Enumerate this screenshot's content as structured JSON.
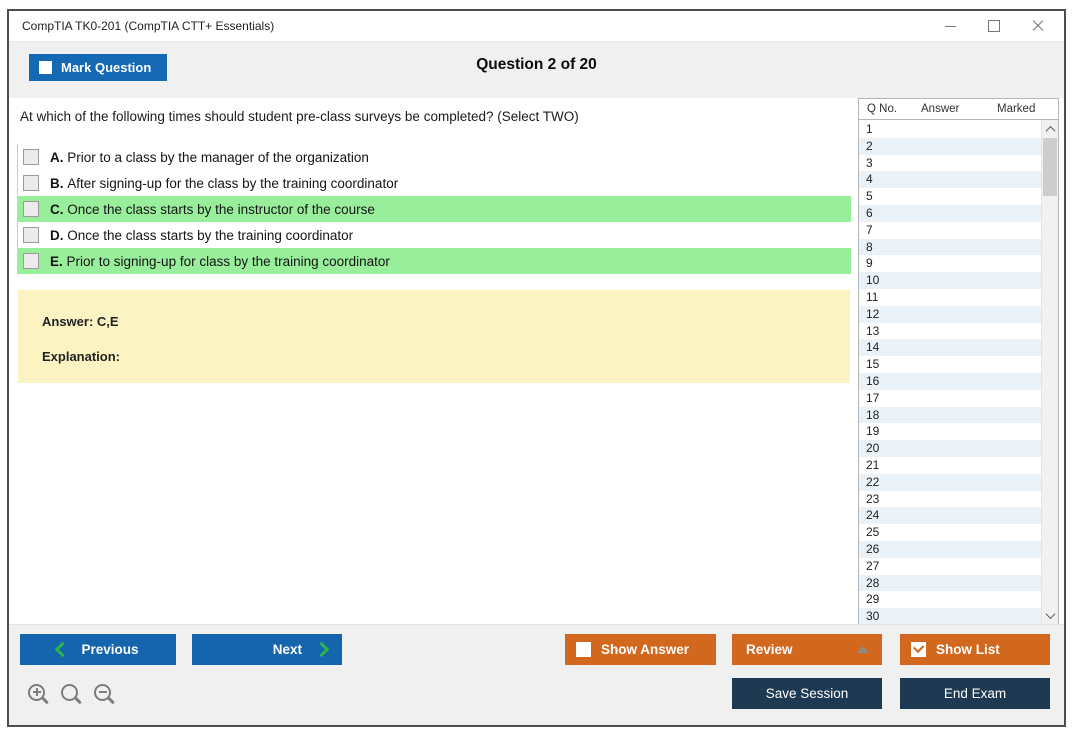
{
  "window": {
    "title": "CompTIA TK0-201 (CompTIA CTT+ Essentials)"
  },
  "header": {
    "mark_question": "Mark Question",
    "question_counter": "Question 2 of 20"
  },
  "question": {
    "text": "At which of the following times should student pre-class surveys be completed? (Select TWO)",
    "options": [
      {
        "letter": "A.",
        "text": "Prior to a class by the manager of the organization",
        "highlighted": false,
        "checked": false
      },
      {
        "letter": "B.",
        "text": "After signing-up for the class by the training coordinator",
        "highlighted": false,
        "checked": false
      },
      {
        "letter": "C.",
        "text": "Once the class starts by the instructor of the course",
        "highlighted": true,
        "checked": false
      },
      {
        "letter": "D.",
        "text": "Once the class starts by the training coordinator",
        "highlighted": false,
        "checked": false
      },
      {
        "letter": "E.",
        "text": "Prior to signing-up for class by the training coordinator",
        "highlighted": true,
        "checked": false
      }
    ],
    "answer": "Answer: C,E",
    "explanation": "Explanation:"
  },
  "question_list": {
    "columns": [
      "Q No.",
      "Answer",
      "Marked"
    ],
    "visible_rows": [
      "1",
      "2",
      "3",
      "4",
      "5",
      "6",
      "7",
      "8",
      "9",
      "10",
      "11",
      "12",
      "13",
      "14",
      "15",
      "16",
      "17",
      "18",
      "19",
      "20",
      "21",
      "22",
      "23",
      "24",
      "25",
      "26",
      "27",
      "28",
      "29",
      "30"
    ]
  },
  "footer": {
    "previous": "Previous",
    "next": "Next",
    "show_answer": "Show Answer",
    "review": "Review",
    "show_list": "Show List",
    "show_list_checked": true,
    "save_session": "Save Session",
    "end_exam": "End Exam"
  },
  "icons": {
    "zoom_tools": [
      "zoom-in-icon",
      "zoom-reset-icon",
      "zoom-out-icon"
    ],
    "window_controls": [
      "minimize-icon",
      "maximize-icon",
      "close-icon"
    ]
  },
  "colors": {
    "accent_blue": "#1565ae",
    "accent_orange": "#d2681e",
    "dark_navy": "#1d3a52",
    "highlight_green": "#98ee9b",
    "answer_yellow": "#fbf4c2",
    "alt_row_blue": "#eaf2f8",
    "chevron_green": "#2db34c"
  }
}
